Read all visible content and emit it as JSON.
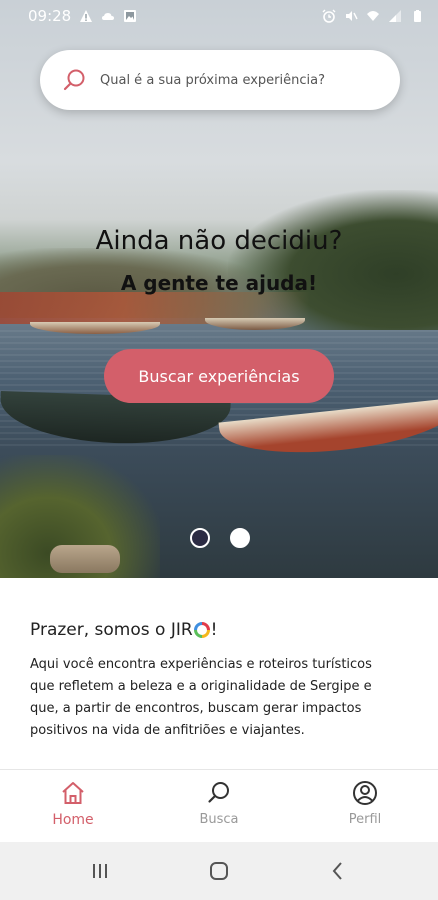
{
  "status_bar": {
    "time": "09:28",
    "left_icons": [
      "warning-icon",
      "cloud-icon",
      "image-icon"
    ],
    "right_icons": [
      "alarm-icon",
      "mute-icon",
      "wifi-icon",
      "signal-icon",
      "battery-icon"
    ]
  },
  "hero": {
    "search_placeholder": "Qual é a sua próxima experiência?",
    "title": "Ainda não decidiu?",
    "subtitle": "A gente te ajuda!",
    "cta_label": "Buscar experiências",
    "carousel": {
      "pages": 2,
      "active": 1
    }
  },
  "intro": {
    "title_prefix": "Prazer, somos o JIR",
    "title_suffix": "!",
    "body": "Aqui você encontra experiências e roteiros turísticos que refletem a beleza e a originalidade de Sergipe e que, a partir de encontros, buscam gerar impactos positivos na vida de anfitriões e viajantes."
  },
  "bottom_nav": {
    "items": [
      {
        "label": "Home",
        "icon": "home-icon",
        "active": true
      },
      {
        "label": "Busca",
        "icon": "search-icon",
        "active": false
      },
      {
        "label": "Perfil",
        "icon": "profile-icon",
        "active": false
      }
    ]
  },
  "colors": {
    "accent": "#d35f6a",
    "active_dot": "#2b2b43",
    "inactive_label": "#999999"
  },
  "system_nav": {
    "buttons": [
      "recents-icon",
      "home-circle-icon",
      "back-icon"
    ]
  }
}
